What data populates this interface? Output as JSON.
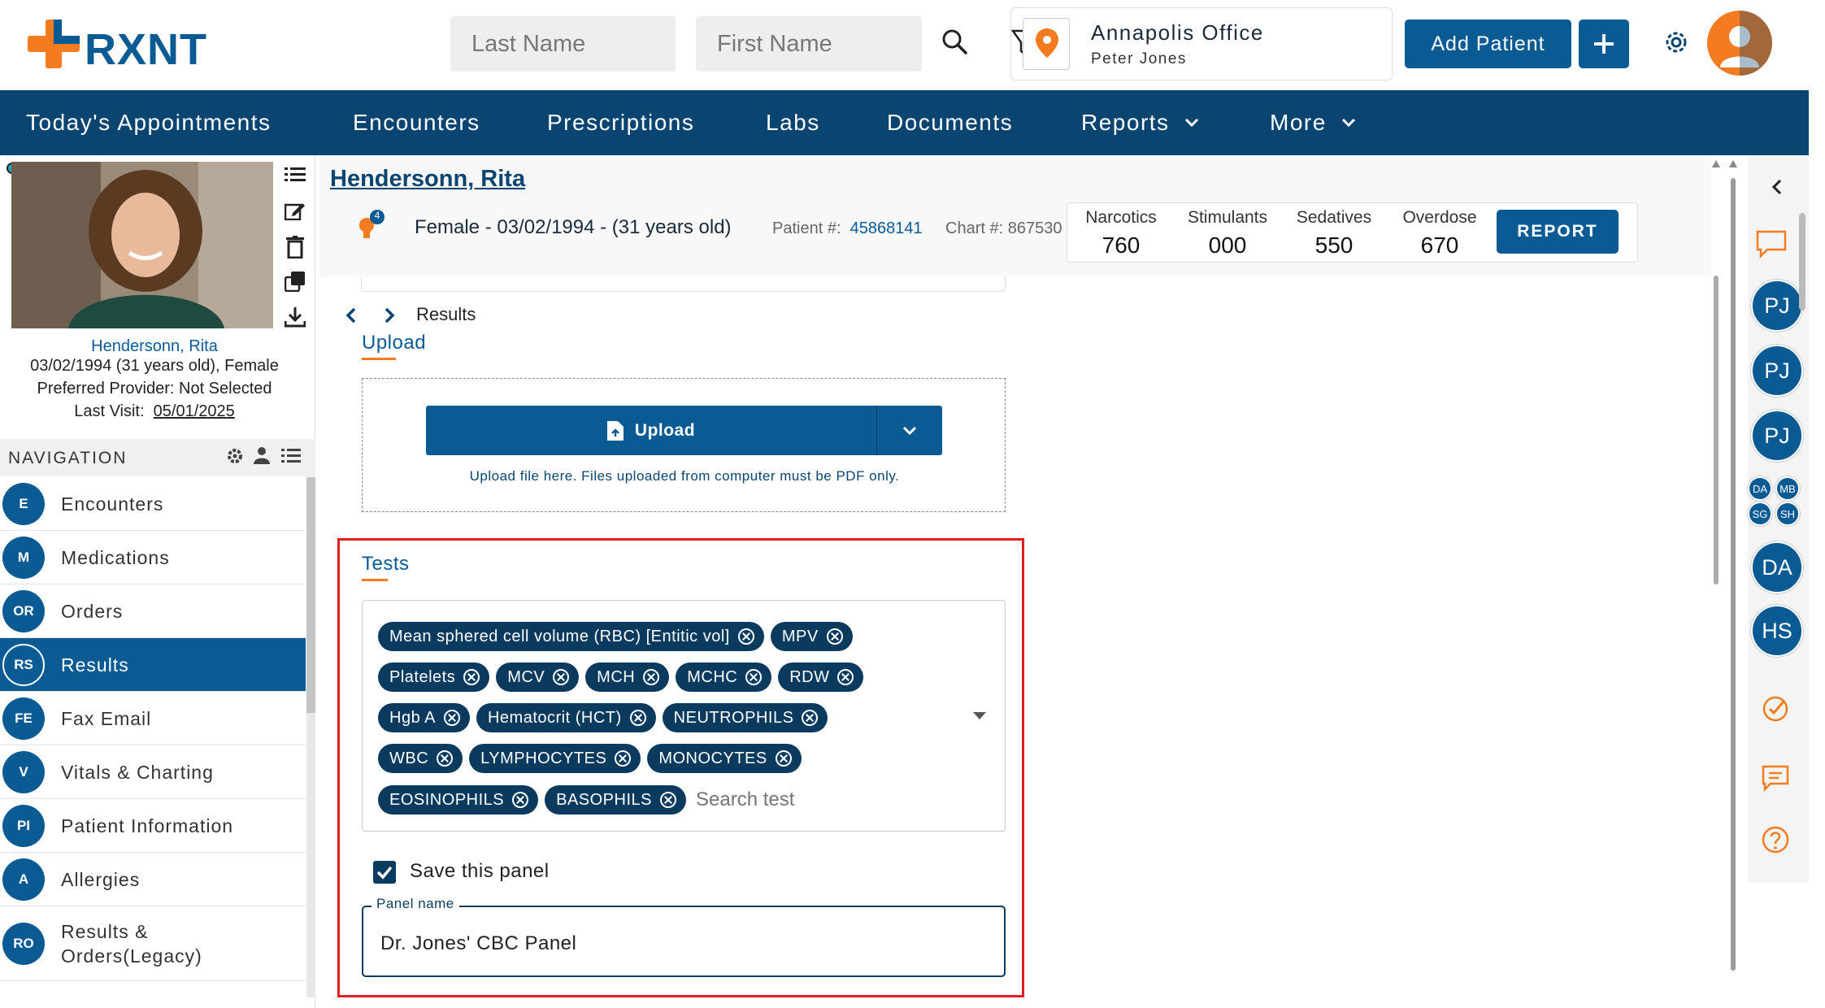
{
  "header": {
    "logo_text": "RXNT",
    "last_name_placeholder": "Last Name",
    "first_name_placeholder": "First Name",
    "office_name": "Annapolis Office",
    "office_user": "Peter Jones",
    "add_patient_label": "Add Patient",
    "accent_color": "#0a5a94",
    "logo_orange": "#f47b20"
  },
  "nav": {
    "items": [
      {
        "label": "Today's Appointments"
      },
      {
        "label": "Encounters"
      },
      {
        "label": "Prescriptions"
      },
      {
        "label": "Labs"
      },
      {
        "label": "Documents"
      },
      {
        "label": "Reports"
      },
      {
        "label": "More"
      }
    ]
  },
  "patient": {
    "name": "Hendersonn, Rita",
    "dob_line": "03/02/1994 (31 years old), Female",
    "provider_line": "Preferred Provider: Not Selected",
    "last_visit_label": "Last Visit:",
    "last_visit_date": "05/01/2025",
    "summary": "Female - 03/02/1994 - (31 years old)",
    "patient_no_label": "Patient #:",
    "patient_no": "45868141",
    "chart_no_label": "Chart #:",
    "chart_no": "867530",
    "alert_count": "4"
  },
  "drugs": [
    {
      "label": "Narcotics",
      "value": "760"
    },
    {
      "label": "Stimulants",
      "value": "000"
    },
    {
      "label": "Sedatives",
      "value": "550"
    },
    {
      "label": "Overdose",
      "value": "670"
    }
  ],
  "report_label": "REPORT",
  "left_nav": {
    "title": "NAVIGATION",
    "items": [
      {
        "abbr": "E",
        "label": "Encounters"
      },
      {
        "abbr": "M",
        "label": "Medications"
      },
      {
        "abbr": "OR",
        "label": "Orders"
      },
      {
        "abbr": "RS",
        "label": "Results"
      },
      {
        "abbr": "FE",
        "label": "Fax Email"
      },
      {
        "abbr": "V",
        "label": "Vitals & Charting"
      },
      {
        "abbr": "PI",
        "label": "Patient Information"
      },
      {
        "abbr": "A",
        "label": "Allergies"
      },
      {
        "abbr": "RO",
        "label": "Results & Orders(Legacy)"
      }
    ],
    "active_index": 3
  },
  "results": {
    "breadcrumb": "Results",
    "upload_tab": "Upload",
    "upload_button": "Upload",
    "upload_hint": "Upload file here. Files uploaded from computer must be PDF only.",
    "tests_tab": "Tests",
    "chips": [
      [
        "Mean sphered cell volume (RBC) [Entitic vol]",
        "MPV"
      ],
      [
        "Platelets",
        "MCV",
        "MCH",
        "MCHC",
        "RDW"
      ],
      [
        "Hgb A",
        "Hematocrit (HCT)",
        "NEUTROPHILS"
      ],
      [
        "WBC",
        "LYMPHOCYTES",
        "MONOCYTES"
      ],
      [
        "EOSINOPHILS",
        "BASOPHILS"
      ]
    ],
    "search_placeholder": "Search test",
    "save_panel_label": "Save this panel",
    "save_panel_checked": true,
    "panel_name_label": "Panel name",
    "panel_name_value": "Dr. Jones' CBC Panel"
  },
  "right_bar": {
    "avatars": [
      "PJ",
      "PJ",
      "PJ"
    ],
    "mini_avatars": [
      "DA",
      "MB",
      "SG",
      "SH"
    ],
    "lower_avatars": [
      "DA",
      "HS"
    ]
  }
}
